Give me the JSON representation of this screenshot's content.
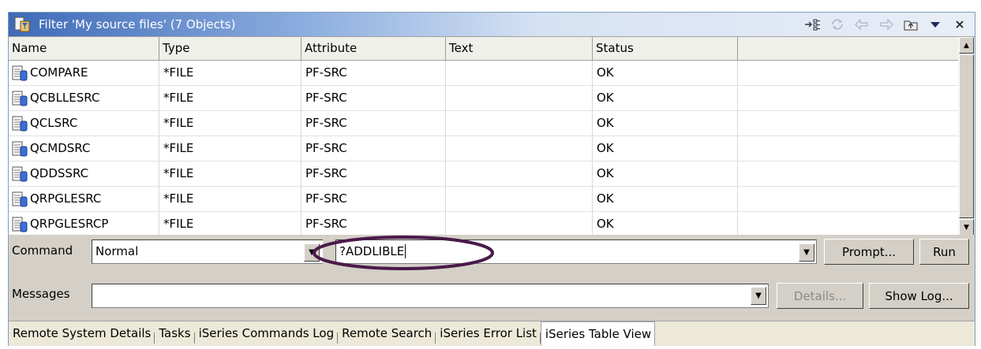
{
  "view": {
    "title": "Filter 'My source files' (7 Objects)",
    "icons": [
      "link-with-editor-icon",
      "refresh-icon",
      "back-icon",
      "forward-icon",
      "up-level-icon",
      "view-menu-icon",
      "close-icon"
    ]
  },
  "table": {
    "columns": [
      "Name",
      "Type",
      "Attribute",
      "Text",
      "Status",
      ""
    ],
    "rows": [
      {
        "name": "COMPARE",
        "type": "*FILE",
        "attribute": "PF-SRC",
        "text": "",
        "status": "OK"
      },
      {
        "name": "QCBLLESRC",
        "type": "*FILE",
        "attribute": "PF-SRC",
        "text": "",
        "status": "OK"
      },
      {
        "name": "QCLSRC",
        "type": "*FILE",
        "attribute": "PF-SRC",
        "text": "",
        "status": "OK"
      },
      {
        "name": "QCMDSRC",
        "type": "*FILE",
        "attribute": "PF-SRC",
        "text": "",
        "status": "OK"
      },
      {
        "name": "QDDSSRC",
        "type": "*FILE",
        "attribute": "PF-SRC",
        "text": "",
        "status": "OK"
      },
      {
        "name": "QRPGLESRC",
        "type": "*FILE",
        "attribute": "PF-SRC",
        "text": "",
        "status": "OK"
      },
      {
        "name": "QRPGLESRCP",
        "type": "*FILE",
        "attribute": "PF-SRC",
        "text": "",
        "status": "OK"
      }
    ]
  },
  "command": {
    "label": "Command",
    "mode": "Normal",
    "value": "?ADDLIBLE",
    "prompt_label": "Prompt...",
    "run_label": "Run"
  },
  "messages": {
    "label": "Messages",
    "value": "",
    "details_label": "Details...",
    "show_log_label": "Show Log..."
  },
  "tabs": [
    "Remote System Details",
    "Tasks",
    "iSeries Commands Log",
    "Remote Search",
    "iSeries Error List",
    "iSeries Table View"
  ],
  "active_tab": "iSeries Table View",
  "colors": {
    "highlight_ellipse": "#4a1a4a",
    "title_gradient_start": "#3e6ab8"
  }
}
